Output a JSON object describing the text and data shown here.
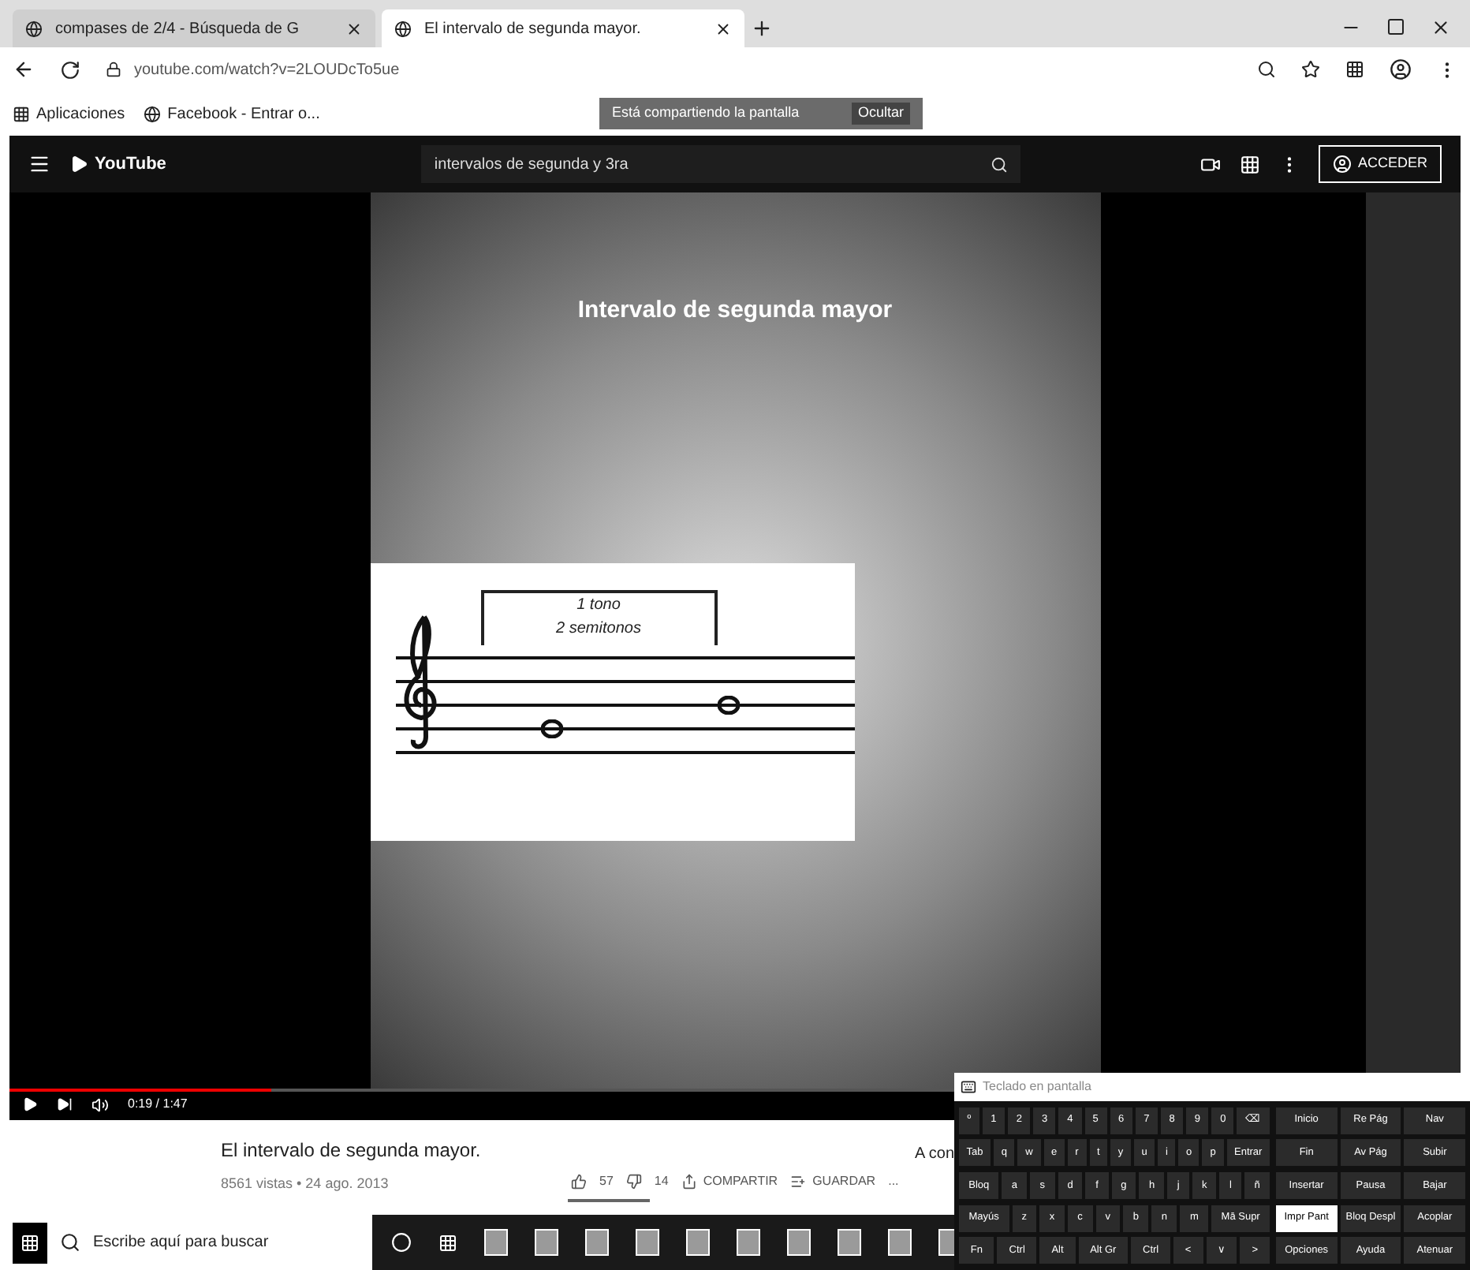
{
  "browser": {
    "tabs": [
      {
        "title": "compases de 2/4 - Búsqueda de G",
        "selected": false
      },
      {
        "title": "El intervalo de segunda mayor.",
        "selected": true
      }
    ],
    "address": "youtube.com/watch?v=2LOUDcTo5ue",
    "bookmarks": [
      "Aplicaciones",
      "Facebook - Entrar o..."
    ],
    "share_banner": {
      "message": "Está compartiendo la pantalla",
      "action": "Ocultar"
    }
  },
  "youtube": {
    "logo": "YouTube",
    "search": "intervalos de segunda y 3ra",
    "sign_in": "ACCEDER"
  },
  "video": {
    "slide_title": "Intervalo de segunda mayor",
    "interval_top": "1 tono",
    "interval_bottom": "2 semitonos",
    "time": "0:19 / 1:47",
    "progress": {
      "level": 0.18
    }
  },
  "info": {
    "title": "El intervalo de segunda mayor.",
    "meta": "8561 vistas • 24 ago. 2013",
    "likes": "57",
    "dislikes": "14",
    "share": "COMPARTIR",
    "save": "GUARDAR",
    "more": "...",
    "up_next": "A con"
  },
  "taskbar": {
    "search_placeholder": "Escribe aquí para buscar"
  },
  "keyboard": {
    "title": "Teclado en pantalla",
    "rows": [
      {
        "keys": [
          {
            "label": "º",
            "selected": false
          },
          {
            "label": "1",
            "selected": false
          },
          {
            "label": "2",
            "selected": false
          },
          {
            "label": "3",
            "selected": false
          },
          {
            "label": "4",
            "selected": false
          },
          {
            "label": "5",
            "selected": false
          },
          {
            "label": "6",
            "selected": false
          },
          {
            "label": "7",
            "selected": false
          },
          {
            "label": "8",
            "selected": false
          },
          {
            "label": "9",
            "selected": false
          },
          {
            "label": "0",
            "selected": false
          },
          {
            "label": "⌫",
            "selected": false
          }
        ]
      },
      {
        "keys": [
          {
            "label": "Tab",
            "selected": false
          },
          {
            "label": "q",
            "selected": false
          },
          {
            "label": "w",
            "selected": false
          },
          {
            "label": "e",
            "selected": false
          },
          {
            "label": "r",
            "selected": false
          },
          {
            "label": "t",
            "selected": false
          },
          {
            "label": "y",
            "selected": false
          },
          {
            "label": "u",
            "selected": false
          },
          {
            "label": "i",
            "selected": false
          },
          {
            "label": "o",
            "selected": false
          },
          {
            "label": "p",
            "selected": false
          },
          {
            "label": "Entrar",
            "selected": false
          }
        ]
      },
      {
        "keys": [
          {
            "label": "Bloq",
            "selected": false
          },
          {
            "label": "a",
            "selected": false
          },
          {
            "label": "s",
            "selected": false
          },
          {
            "label": "d",
            "selected": false
          },
          {
            "label": "f",
            "selected": false
          },
          {
            "label": "g",
            "selected": false
          },
          {
            "label": "h",
            "selected": false
          },
          {
            "label": "j",
            "selected": false
          },
          {
            "label": "k",
            "selected": false
          },
          {
            "label": "l",
            "selected": false
          },
          {
            "label": "ñ",
            "selected": false
          }
        ]
      },
      {
        "keys": [
          {
            "label": "Mayús",
            "selected": false
          },
          {
            "label": "z",
            "selected": false
          },
          {
            "label": "x",
            "selected": false
          },
          {
            "label": "c",
            "selected": false
          },
          {
            "label": "v",
            "selected": false
          },
          {
            "label": "b",
            "selected": false
          },
          {
            "label": "n",
            "selected": false
          },
          {
            "label": "m",
            "selected": false
          },
          {
            "label": "Mā Supr",
            "selected": false
          }
        ]
      },
      {
        "keys": [
          {
            "label": "Fn",
            "selected": false
          },
          {
            "label": "Ctrl",
            "selected": false
          },
          {
            "label": "Alt",
            "selected": false
          },
          {
            "label": "Alt Gr",
            "selected": false
          },
          {
            "label": "Ctrl",
            "selected": false
          },
          {
            "label": "<",
            "selected": false
          },
          {
            "label": "∨",
            "selected": false
          },
          {
            "label": ">",
            "selected": false
          }
        ]
      }
    ],
    "nav_keys": [
      [
        {
          "label": "Inicio",
          "selected": false
        },
        {
          "label": "Re Pág",
          "selected": false
        },
        {
          "label": "Nav",
          "selected": false
        }
      ],
      [
        {
          "label": "Fin",
          "selected": false
        },
        {
          "label": "Av Pág",
          "selected": false
        },
        {
          "label": "Subir",
          "selected": false
        }
      ],
      [
        {
          "label": "Insertar",
          "selected": false
        },
        {
          "label": "Pausa",
          "selected": false
        },
        {
          "label": "Bajar",
          "selected": false
        }
      ],
      [
        {
          "label": "Impr Pant",
          "selected": true
        },
        {
          "label": "Bloq Despl",
          "selected": false
        },
        {
          "label": "Acoplar",
          "selected": false
        }
      ],
      [
        {
          "label": "Opciones",
          "selected": false
        },
        {
          "label": "Ayuda",
          "selected": false
        },
        {
          "label": "Atenuar",
          "selected": false
        }
      ]
    ]
  }
}
